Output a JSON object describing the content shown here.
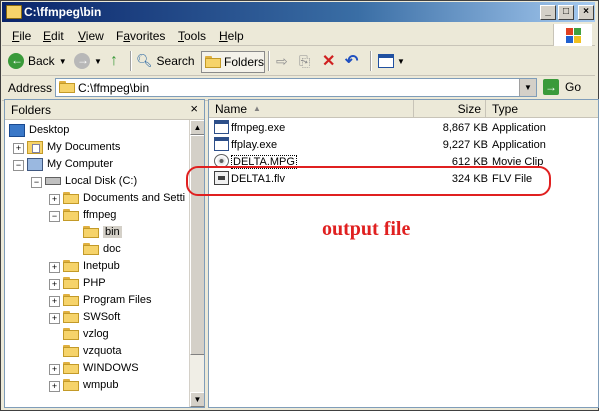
{
  "window": {
    "title": "C:\\ffmpeg\\bin"
  },
  "window_controls": {
    "minimize": "_",
    "maximize": "□",
    "close": "×"
  },
  "menu": [
    "File",
    "Edit",
    "View",
    "Favorites",
    "Tools",
    "Help"
  ],
  "menu_accel": [
    "F",
    "E",
    "V",
    "a",
    "T",
    "H"
  ],
  "toolbar": {
    "back_label": "Back",
    "search_label": "Search",
    "folders_label": "Folders"
  },
  "address": {
    "label": "Address",
    "value": "C:\\ffmpeg\\bin",
    "go_label": "Go"
  },
  "folders_pane": {
    "title": "Folders",
    "close": "×",
    "tree": [
      {
        "label": "Desktop"
      },
      {
        "label": "My Documents"
      },
      {
        "label": "My Computer"
      },
      {
        "label": "Local Disk (C:)"
      },
      {
        "label": "Documents and Setti"
      },
      {
        "label": "ffmpeg"
      },
      {
        "label": "bin"
      },
      {
        "label": "doc"
      },
      {
        "label": "Inetpub"
      },
      {
        "label": "PHP"
      },
      {
        "label": "Program Files"
      },
      {
        "label": "SWSoft"
      },
      {
        "label": "vzlog"
      },
      {
        "label": "vzquota"
      },
      {
        "label": "WINDOWS"
      },
      {
        "label": "wmpub"
      }
    ]
  },
  "file_list": {
    "columns": {
      "name": "Name",
      "size": "Size",
      "type": "Type"
    },
    "files": [
      {
        "name": "ffmpeg.exe",
        "size": "8,867 KB",
        "type": "Application",
        "icon": "exe-icon"
      },
      {
        "name": "ffplay.exe",
        "size": "9,227 KB",
        "type": "Application",
        "icon": "exe-icon"
      },
      {
        "name": "DELTA.MPG",
        "size": "612 KB",
        "type": "Movie Clip",
        "icon": "mpg-icon"
      },
      {
        "name": "DELTA1.flv",
        "size": "324 KB",
        "type": "FLV File",
        "icon": "flv-icon"
      }
    ]
  },
  "annotation": {
    "text": "output file",
    "color": "#e02020"
  },
  "colors": {
    "title_start": "#0a246a",
    "title_end": "#a6caf0",
    "chrome": "#ece9d8",
    "folder": "#f6d36a"
  }
}
